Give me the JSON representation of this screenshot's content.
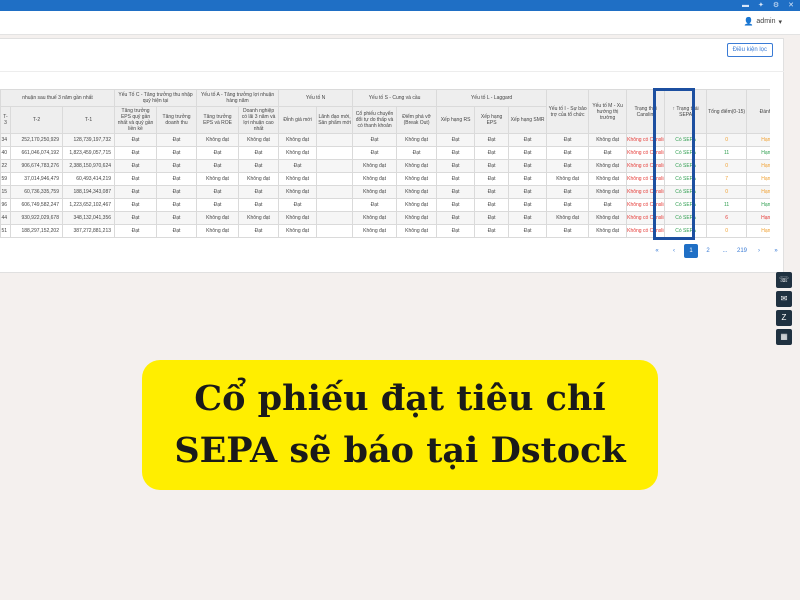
{
  "browser": {
    "icons": [
      "minimize-icon",
      "pin-icon",
      "settings-icon",
      "close-icon"
    ]
  },
  "topnav": {
    "user": "admin"
  },
  "panel": {
    "filter_button": "Điều kiện lọc"
  },
  "table": {
    "group_headers": [
      "nhuận sau thuế 3 năm gần nhất",
      "Yếu Tố C - Tăng trưởng thu nhập quý hiện tại",
      "Yếu tố A - Tăng trưởng lợi nhuận hàng năm",
      "Yếu tố N",
      "Yếu tố S - Cung và cầu",
      "Yếu tố L - Laggard",
      "Yếu tố I - Sự bảo trợ của tổ chức",
      "Yếu tố M - Xu hướng thị trường",
      "Trạng thái Canslim",
      "Trạng thái SEPA",
      "Tổng điểm(0-15)",
      "Đánh giá"
    ],
    "sub_headers": [
      "T-3",
      "T-2",
      "T-1",
      "Tăng trưởng EPS quý gần nhất và quý gần liền kề",
      "Tăng trưởng doanh thu",
      "Tăng trưởng EPS và ROE",
      "Doanh nghiệp có lãi 3 năm và lợi nhuận cao nhất",
      "Đỉnh giá mới",
      "Lãnh đạo mới, Sản phẩm mới",
      "Cổ phiếu chuyển đổi tự do thấp và có thanh khoản",
      "Điểm phá vỡ (Break Out)",
      "Xếp hạng RS",
      "Xếp hạng EPS",
      "Xếp hạng SMR"
    ],
    "rows": [
      [
        "34",
        "252,170,250,929",
        "128,739,197,732",
        "Đạt",
        "Đạt",
        "Không đạt",
        "Không đạt",
        "Không đạt",
        "",
        "Đạt",
        "Không đạt",
        "Đạt",
        "Đạt",
        "Đạt",
        "Đạt",
        "Không đạt",
        "Không có Canslim",
        "Có SEPA",
        "0",
        "Hạng E"
      ],
      [
        "40",
        "661,046,074,192",
        "1,823,459,057,715",
        "Đạt",
        "Đạt",
        "Đạt",
        "Đạt",
        "Không đạt",
        "",
        "Đạt",
        "Đạt",
        "Đạt",
        "Đạt",
        "Đạt",
        "Đạt",
        "Đạt",
        "Không có Canslim",
        "Có SEPA",
        "11",
        "Hạng B"
      ],
      [
        "22",
        "906,674,783,276",
        "2,388,150,970,624",
        "Đạt",
        "Đạt",
        "Đạt",
        "Đạt",
        "Đạt",
        "",
        "Không đạt",
        "Không đạt",
        "Đạt",
        "Đạt",
        "Đạt",
        "Đạt",
        "Không đạt",
        "Không có Canslim",
        "Có SEPA",
        "0",
        "Hạng E"
      ],
      [
        "59",
        "37,014,946,479",
        "60,493,414,219",
        "Đạt",
        "Đạt",
        "Không đạt",
        "Không đạt",
        "Không đạt",
        "",
        "Không đạt",
        "Không đạt",
        "Đạt",
        "Đạt",
        "Đạt",
        "Không đạt",
        "Không đạt",
        "Không có Canslim",
        "Có SEPA",
        "7",
        "Hạng E"
      ],
      [
        "15",
        "60,736,335,759",
        "188,194,343,087",
        "Đạt",
        "Đạt",
        "Đạt",
        "Đạt",
        "Không đạt",
        "",
        "Không đạt",
        "Không đạt",
        "Đạt",
        "Đạt",
        "Đạt",
        "Đạt",
        "Không đạt",
        "Không có Canslim",
        "Có SEPA",
        "0",
        "Hạng E"
      ],
      [
        "96",
        "606,749,582,247",
        "1,223,652,102,467",
        "Đạt",
        "Đạt",
        "Đạt",
        "Đạt",
        "Đạt",
        "",
        "Đạt",
        "Không đạt",
        "Đạt",
        "Đạt",
        "Đạt",
        "Đạt",
        "Đạt",
        "Không có Canslim",
        "Có SEPA",
        "11",
        "Hạng B"
      ],
      [
        "44",
        "930,922,029,678",
        "348,132,041,356",
        "Đạt",
        "Đạt",
        "Không đạt",
        "Không đạt",
        "Không đạt",
        "",
        "Không đạt",
        "Không đạt",
        "Đạt",
        "Đạt",
        "Đạt",
        "Không đạt",
        "Không đạt",
        "Không có Canslim",
        "Có SEPA",
        "6",
        "Hạng D"
      ],
      [
        "51",
        "188,297,152,202",
        "387,272,881,213",
        "Đạt",
        "Đạt",
        "Không đạt",
        "Đạt",
        "Không đạt",
        "",
        "Không đạt",
        "Không đạt",
        "Đạt",
        "Đạt",
        "Đạt",
        "Đạt",
        "Không đạt",
        "Không có Canslim",
        "Có SEPA",
        "0",
        "Hạng E"
      ]
    ]
  },
  "pagination": {
    "first": "«",
    "prev": "‹",
    "current": "1",
    "page2": "2",
    "ellipsis": "...",
    "last_page": "219",
    "next": "›",
    "last": "»"
  },
  "sidebar_tools": [
    "phone-icon",
    "messenger-icon",
    "zalo-icon",
    "calendar-icon"
  ],
  "callout": {
    "line1": "Cổ phiếu đạt tiêu chí",
    "line2": "SEPA sẽ báo tại Dstock"
  },
  "colors": {
    "accent": "#1f6fc5",
    "highlight": "#1c4fa0",
    "callout_bg": "#ffee00",
    "fail": "#e53935",
    "pass": "#2e9e4f"
  }
}
